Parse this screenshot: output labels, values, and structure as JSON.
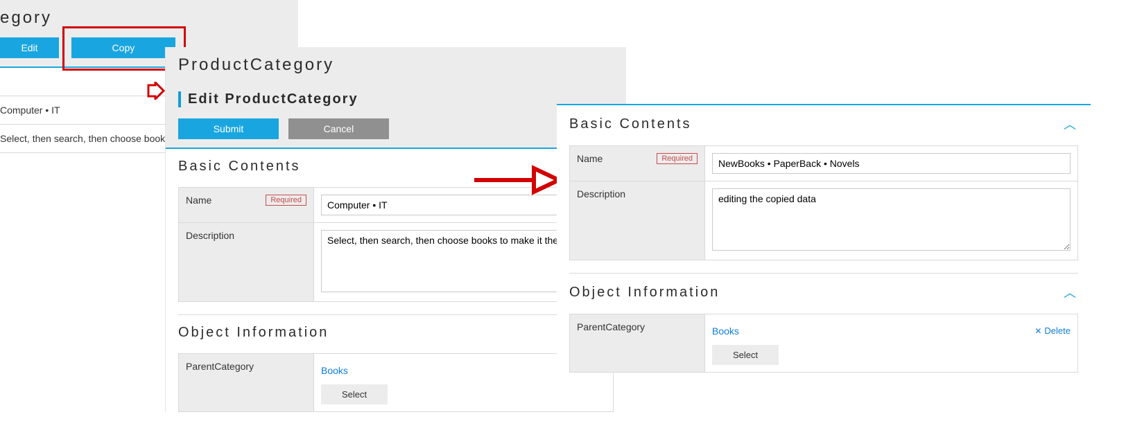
{
  "panel1": {
    "title_partial": "egory",
    "buttons": {
      "edit": "Edit",
      "copy": "Copy"
    },
    "rows": {
      "name_value": "Computer • IT",
      "desc_value": "Select, then search, then choose books"
    }
  },
  "panel2": {
    "title": "ProductCategory",
    "subtitle": "Edit ProductCategory",
    "buttons": {
      "submit": "Submit",
      "cancel": "Cancel"
    },
    "sections": {
      "basic": {
        "heading": "Basic Contents",
        "name_label": "Name",
        "required": "Required",
        "name_value": "Computer • IT",
        "desc_label": "Description",
        "desc_value": "Select, then search, then choose books to make it the p"
      },
      "object": {
        "heading": "Object Information",
        "parent_label": "ParentCategory",
        "parent_value": "Books",
        "select": "Select"
      }
    }
  },
  "panel3": {
    "sections": {
      "basic": {
        "heading": "Basic Contents",
        "name_label": "Name",
        "required": "Required",
        "name_value": "NewBooks • PaperBack • Novels",
        "desc_label": "Description",
        "desc_value": "editing the copied data"
      },
      "object": {
        "heading": "Object Information",
        "parent_label": "ParentCategory",
        "parent_value": "Books",
        "select": "Select",
        "delete": "Delete"
      }
    }
  }
}
